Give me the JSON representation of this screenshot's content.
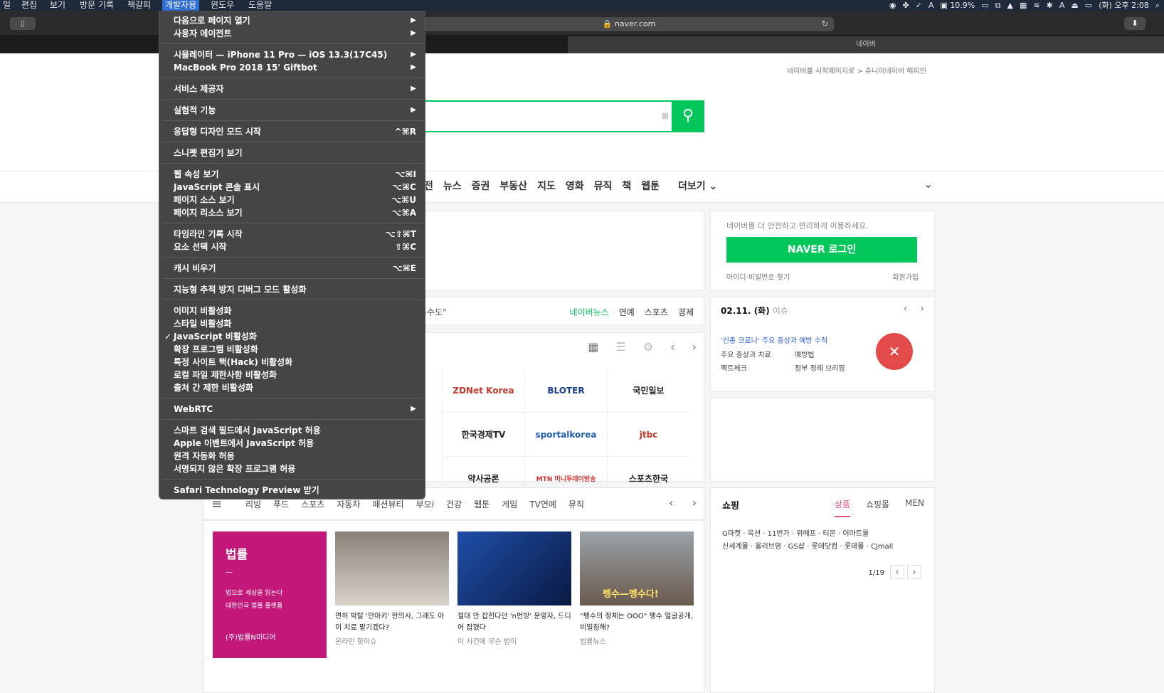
{
  "menubar": {
    "items": [
      "일",
      "편집",
      "보기",
      "방문 기록",
      "책갈피",
      "개발자용",
      "윈도우",
      "도움말"
    ],
    "active_index": 5,
    "tray": {
      "battery_stat": "10.9%",
      "clock": "(화) 오후 2:08"
    }
  },
  "toolbar": {
    "address": "naver.com"
  },
  "tabbar": {
    "active_tab": "네이버"
  },
  "dev_menu": {
    "items": [
      {
        "label": "다음으로 페이지 열기",
        "submenu": true
      },
      {
        "label": "사용자 에이전트",
        "submenu": true
      },
      {
        "label": "시뮬레이터 — iPhone 11 Pro — iOS 13.3(17C45)",
        "submenu": true
      },
      {
        "label": "MacBook Pro 2018 15' Giftbot",
        "submenu": true
      },
      {
        "label": "서비스 제공자",
        "submenu": true
      },
      {
        "label": "실험적 기능",
        "submenu": true
      },
      {
        "label": "응답형 디자인 모드 시작",
        "shortcut": "^⌘R"
      },
      {
        "label": "스니펫 편집기 보기"
      },
      {
        "label": "웹 속성 보기",
        "shortcut": "⌥⌘I"
      },
      {
        "label": "JavaScript 콘솔 표시",
        "shortcut": "⌥⌘C"
      },
      {
        "label": "페이지 소스 보기",
        "shortcut": "⌥⌘U"
      },
      {
        "label": "페이지 리소스 보기",
        "shortcut": "⌥⌘A"
      },
      {
        "label": "타임라인 기록 시작",
        "shortcut": "⌥⇧⌘T"
      },
      {
        "label": "요소 선택 시작",
        "shortcut": "⇧⌘C"
      },
      {
        "label": "캐시 비우기",
        "shortcut": "⌥⌘E"
      },
      {
        "label": "지능형 추적 방지 디버그 모드 활성화"
      },
      {
        "label": "이미지 비활성화"
      },
      {
        "label": "스타일 비활성화"
      },
      {
        "label": "JavaScript 비활성화",
        "checked": true
      },
      {
        "label": "확장 프로그램 비활성화"
      },
      {
        "label": "특정 사이트 핵(Hack) 비활성화"
      },
      {
        "label": "로컬 파일 제한사항 비활성화"
      },
      {
        "label": "출처 간 제한 비활성화"
      },
      {
        "label": "WebRTC",
        "submenu": true
      },
      {
        "label": "스마트 검색 필드에서 JavaScript 허용"
      },
      {
        "label": "Apple 이벤트에서 JavaScript 허용"
      },
      {
        "label": "원격 자동화 허용"
      },
      {
        "label": "서명되지 않은 확장 프로그램 허용"
      },
      {
        "label": "Safari Technology Preview 받기"
      }
    ]
  },
  "naver": {
    "top_links": "네이버를 시작페이지로 > 쥬니어네이버 해피빈",
    "nav": [
      "전",
      "뉴스",
      "증권",
      "부동산",
      "지도",
      "영화",
      "뮤직",
      "책",
      "웹툰"
    ],
    "nav_more": "더보기",
    "login": {
      "notice": "네이버를 더 안전하고 편리하게 이용하세요.",
      "button": "NAVER 로그인",
      "find": "아이디·비밀번호 찾기",
      "join": "회원가입"
    },
    "news": {
      "headline_tail": "음수도\"",
      "tabs": [
        "네이버뉴스",
        "연예",
        "스포츠",
        "경제"
      ]
    },
    "press": [
      "ZDNet Korea",
      "BLOTER",
      "국민일보",
      "한국경제TV",
      "sportalkorea",
      "jtbc",
      "약사공론",
      "MTN 머니투데이방송",
      "스포츠한국"
    ],
    "issue": {
      "date": "02.11. (화)",
      "label": "이슈",
      "title": "'신종 코로나' 주요 증상과 예방 수칙",
      "items": [
        "주요 증상과 치료",
        "예방법",
        "팩트체크",
        "정부 정례 브리핑"
      ]
    },
    "categories": [
      "리빙",
      "푸드",
      "스포츠",
      "자동차",
      "패션뷰티",
      "부모i",
      "건강",
      "웹툰",
      "게임",
      "TV연예",
      "뮤직"
    ],
    "promo": {
      "title": "법률",
      "dash": "—",
      "line1": "법으로 세상을 읽는다",
      "line2": "대한민국 법률 플랫폼",
      "org": "(주)법률N미디어"
    },
    "feed": [
      {
        "title": "면허 박탈 '안아키' 한의사, 그래도 아이 치료 맡기겠다?",
        "source": "온라인 핫이슈"
      },
      {
        "title": "절대 안 잡힌다던 'n번방' 운영자, 드디어 잡혔다",
        "source": "이 사건에 무슨 법이"
      },
      {
        "title": "\"펭수의 정체는 OOO\" 펭수 얼굴공개, 비밀침해?",
        "source": "법률뉴스"
      }
    ],
    "feed_img_caption": "펭수—펭수다!",
    "shopping": {
      "title": "쇼핑",
      "tabs": [
        "상품",
        "쇼핑몰",
        "MEN"
      ],
      "links1": "G마켓 · 옥션 · 11번가 · 위메프 · 티몬 · 이마트몰",
      "links2": "신세계몰 · 올리브영 · GS샵 · 롯데닷컴 · 롯데몰 · CJmall",
      "page": "1/19"
    }
  }
}
